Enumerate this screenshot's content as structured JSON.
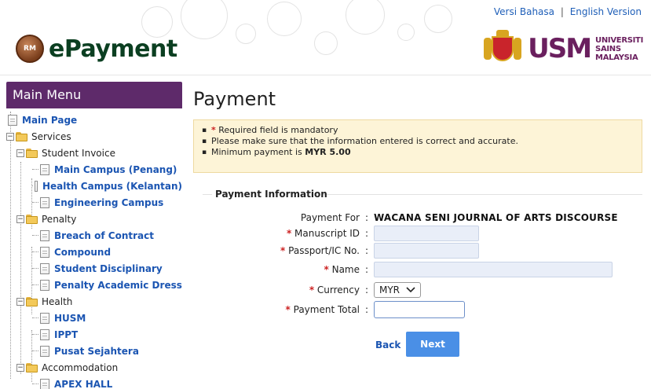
{
  "header": {
    "lang_malay": "Versi Bahasa",
    "lang_sep": "|",
    "lang_english": "English Version",
    "logo_badge": "RM",
    "logo_text": "ePayment",
    "usm_mark": "USM",
    "usm_line1": "UNIVERSITI",
    "usm_line2": "SAINS",
    "usm_line3": "MALAYSIA"
  },
  "sidebar": {
    "title": "Main Menu",
    "main_page": "Main Page",
    "services": "Services",
    "student_invoice": "Student Invoice",
    "invoice_items": [
      "Main Campus (Penang)",
      "Health Campus (Kelantan)",
      "Engineering Campus"
    ],
    "penalty": "Penalty",
    "penalty_items": [
      "Breach of Contract",
      "Compound",
      "Student Disciplinary",
      "Penalty Academic Dress"
    ],
    "health": "Health",
    "health_items": [
      "HUSM",
      "IPPT",
      "Pusat Sejahtera"
    ],
    "accommodation": "Accommodation",
    "accommodation_items": [
      "APEX HALL"
    ]
  },
  "main": {
    "title": "Payment",
    "notice": {
      "asterisk": "*",
      "line1": "Required field is mandatory",
      "line2": "Please make sure that the information entered is correct and accurate.",
      "line3_prefix": "Minimum payment is",
      "line3_amount": "MYR 5.00"
    },
    "section_title": "Payment Information",
    "form": {
      "payment_for_label": "Payment For",
      "payment_for_value": "WACANA SENI JOURNAL OF ARTS DISCOURSE",
      "manuscript_label": "Manuscript ID",
      "passport_label": "Passport/IC No.",
      "name_label": "Name",
      "currency_label": "Currency",
      "currency_value": "MYR",
      "total_label": "Payment Total",
      "colon": ":",
      "asterisk": "*"
    },
    "back_label": "Back",
    "next_label": "Next"
  },
  "colors": {
    "menu_purple": "#5e2a6a",
    "link_blue": "#1b55b2",
    "next_button": "#4a8fe6",
    "notice_bg": "#fdf4d7",
    "required_red": "#cc2222"
  }
}
